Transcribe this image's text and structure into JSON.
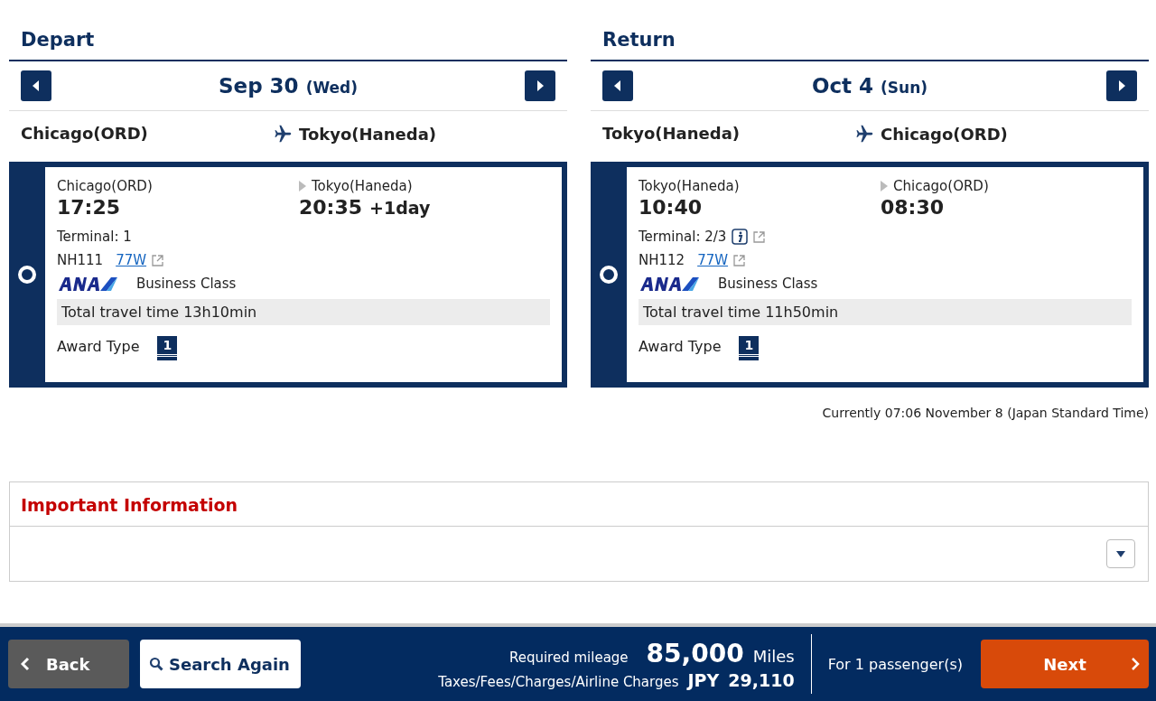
{
  "legs": [
    {
      "heading": "Depart",
      "date": "Sep 30",
      "weekday": "(Wed)",
      "from": "Chicago(ORD)",
      "to": "Tokyo(Haneda)",
      "flight": {
        "selected": true,
        "dep_city": "Chicago(ORD)",
        "dep_time": "17:25",
        "arr_city": "Tokyo(Haneda)",
        "arr_time": "20:35",
        "day_offset": "+1day",
        "terminal": "Terminal: 1",
        "terminal_info": false,
        "number": "NH111",
        "aircraft": "77W",
        "cabin": "Business Class",
        "travel_time": "Total travel time 13h10min",
        "award_label": "Award Type",
        "award_type": "1"
      }
    },
    {
      "heading": "Return",
      "date": "Oct 4",
      "weekday": "(Sun)",
      "from": "Tokyo(Haneda)",
      "to": "Chicago(ORD)",
      "flight": {
        "selected": true,
        "dep_city": "Tokyo(Haneda)",
        "dep_time": "10:40",
        "arr_city": "Chicago(ORD)",
        "arr_time": "08:30",
        "terminal": "Terminal: 2/3",
        "terminal_info": true,
        "number": "NH112",
        "aircraft": "77W",
        "cabin": "Business Class",
        "travel_time": "Total travel time 11h50min",
        "award_label": "Award Type",
        "award_type": "1"
      }
    }
  ],
  "current_time": "Currently 07:06 November 8 (Japan Standard Time)",
  "important": {
    "title": "Important Information",
    "expanded": false
  },
  "footer": {
    "back": "Back",
    "search_again": "Search Again",
    "mileage_label": "Required mileage",
    "mileage": "85,000",
    "mileage_unit": "Miles",
    "taxes_label": "Taxes/Fees/Charges/Airline Charges",
    "currency": "JPY",
    "taxes": "29,110",
    "passengers": "For 1 passenger(s)",
    "next": "Next"
  }
}
